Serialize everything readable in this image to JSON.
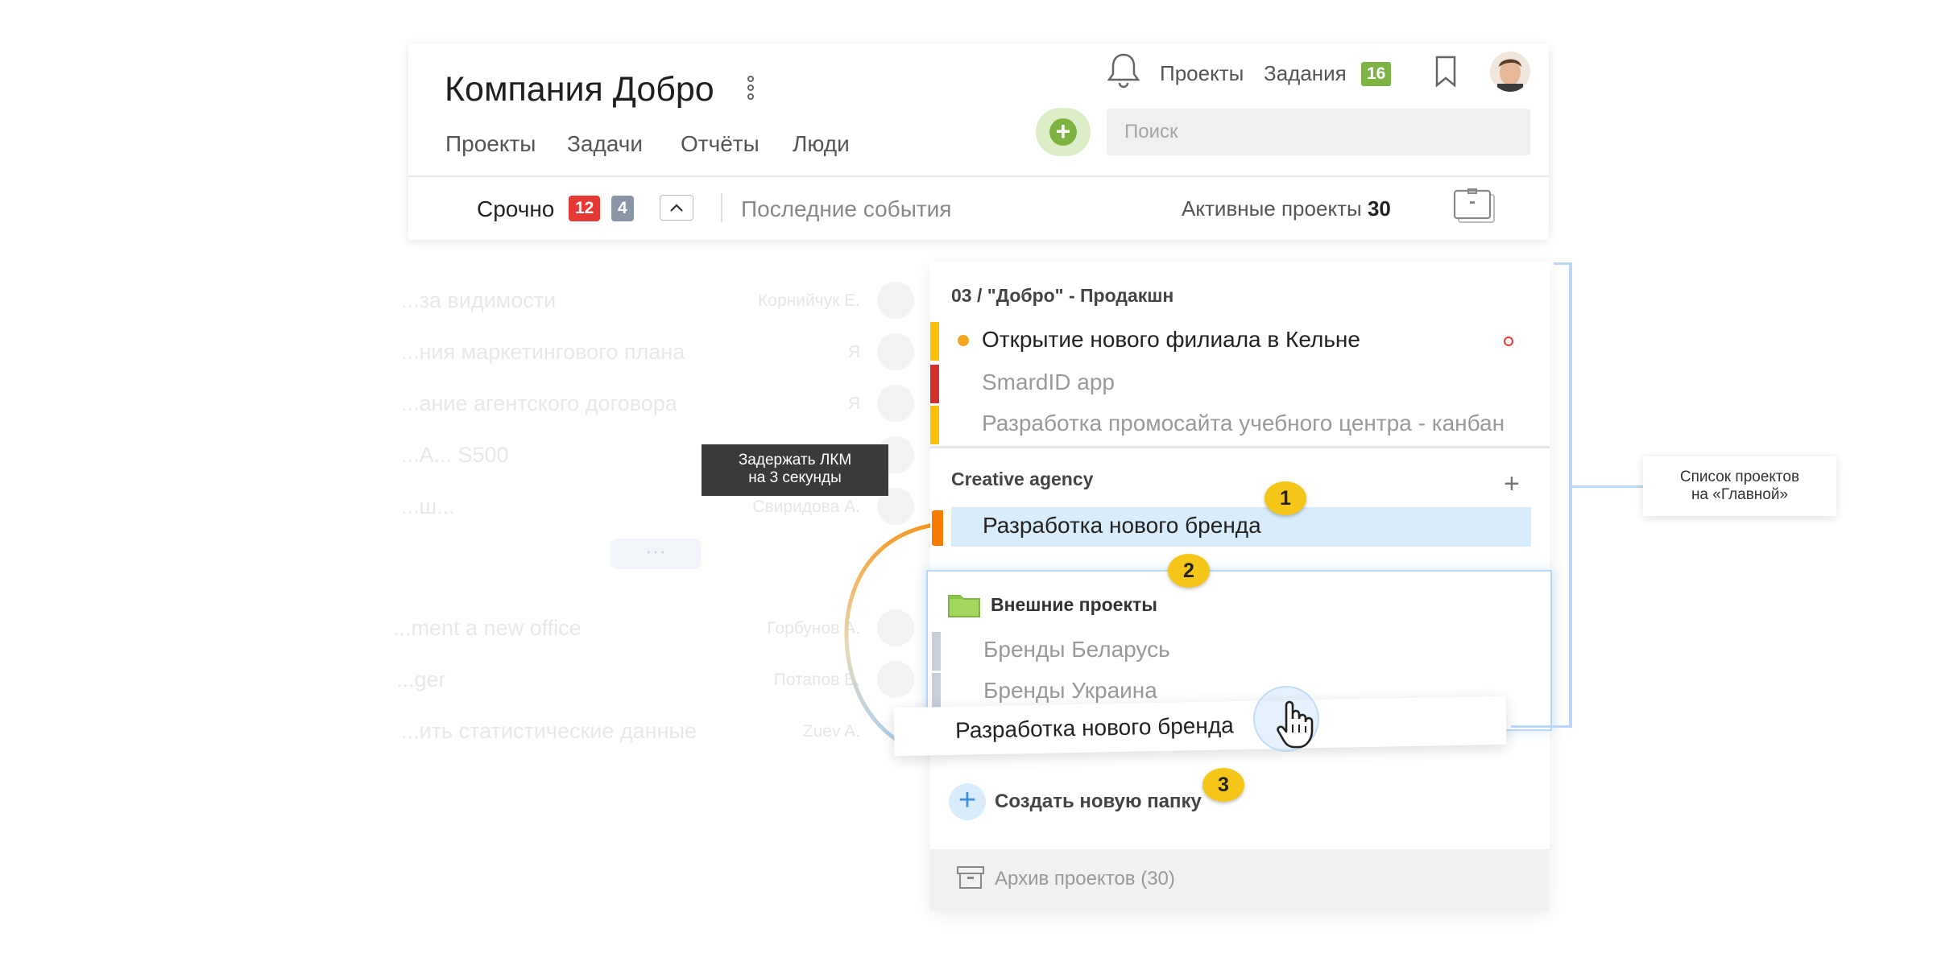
{
  "header": {
    "title": "Компания Добро",
    "nav": [
      "Проекты",
      "Задачи",
      "Отчёты",
      "Люди"
    ],
    "top_links": {
      "projects": "Проекты",
      "tasks": "Задания",
      "tasks_count": "16"
    },
    "search_placeholder": "Поиск",
    "urgent": {
      "label": "Срочно",
      "red_count": "12",
      "gray_count": "4"
    },
    "recent_events": "Последние события",
    "active_projects": {
      "label": "Активные проекты",
      "count": "30"
    }
  },
  "background_tasks": [
    {
      "title": "...за видимости",
      "assignee": "Корнийчук Е."
    },
    {
      "title": "...ния маркетингового плана",
      "assignee": "Я"
    },
    {
      "title": "...ание агентского договора",
      "assignee": "Я"
    },
    {
      "title": "...A... S500",
      "assignee": ""
    },
    {
      "title": "...ш...",
      "assignee": "Свиридова А."
    },
    {
      "title": "...ment a new office",
      "assignee": "Горбунов А."
    },
    {
      "title": "...ger",
      "assignee": "Потапов В."
    },
    {
      "title": "...ить статистические данные",
      "assignee": "Zuev A."
    }
  ],
  "background_more": "···",
  "tooltip": {
    "line1": "Задержать ЛКМ",
    "line2": "на 3 секунды"
  },
  "panel": {
    "group1": {
      "title": "03 / \"Добро\" - Продакшн",
      "projects": [
        {
          "name": "Открытие нового филиала в Кельне",
          "color": "#ffc107"
        },
        {
          "name": "SmardID app",
          "color": "#d32f2f"
        },
        {
          "name": "Разработка промосайта учебного центра - канбан",
          "color": "#ffc107"
        }
      ]
    },
    "group2": {
      "title": "Creative agency",
      "highlighted_project": "Разработка нового бренда",
      "add_symbol": "+"
    },
    "folder": {
      "title": "Внешние проекты",
      "projects": [
        "Бренды Беларусь",
        "Бренды Украина"
      ]
    },
    "dragged_card": "Разработка нового бренда",
    "create_folder": "Создать новую папку",
    "archive": "Архив проектов (30)"
  },
  "steps": [
    "1",
    "2",
    "3"
  ],
  "side_label": {
    "line1": "Список проектов",
    "line2": "на «Главной»"
  },
  "colors": {
    "accent_green": "#7cb342",
    "badge_red": "#e53935",
    "drag_orange": "#f57c00",
    "highlight_blue": "#d8ecfb",
    "step_yellow": "#f5c518"
  },
  "icons": [
    "kebab-icon",
    "bell-icon",
    "bookmark-icon",
    "briefcase-icon",
    "plus-icon",
    "chevron-up-icon",
    "folder-icon",
    "archive-icon",
    "hand-cursor-icon",
    "dot-icon"
  ]
}
